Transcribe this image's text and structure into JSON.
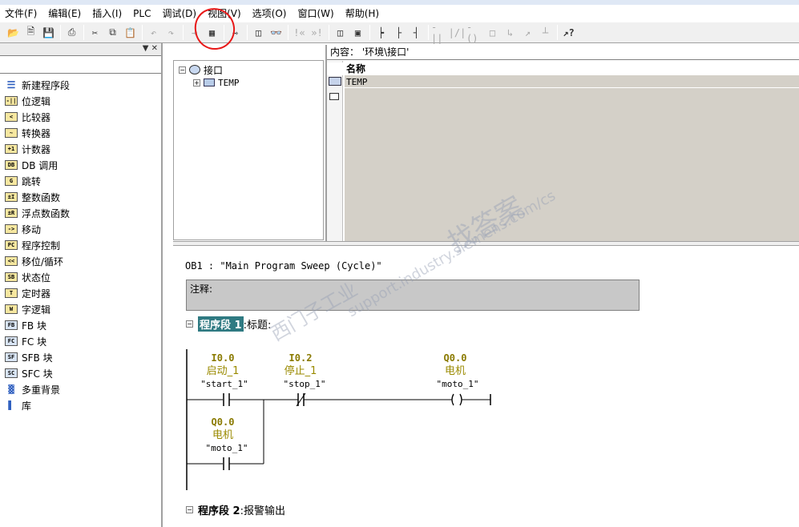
{
  "menu": [
    "文件(F)",
    "编辑(E)",
    "插入(I)",
    "PLC",
    "调试(D)",
    "视图(V)",
    "选项(O)",
    "窗口(W)",
    "帮助(H)"
  ],
  "toolbar_icons": [
    "new-icon",
    "open-icon",
    "save-icon",
    "print-icon",
    "cut-icon",
    "copy-icon",
    "paste-icon",
    "undo-icon",
    "redo-icon",
    "download-icon",
    "module-info-icon",
    "overview-icon",
    "accessible-nodes-icon",
    "monitor-icon",
    "network-prev-icon",
    "network-next-icon",
    "detail-view-icon",
    "overview-window-icon",
    "ladder-insert-icon",
    "branch-open-icon",
    "branch-close-icon",
    "contact-no-icon",
    "contact-nc-icon",
    "coil-icon",
    "empty-box-icon",
    "branch-arrow-icon",
    "connection-icon",
    "help-icon"
  ],
  "left_panel": {
    "items": [
      {
        "label": "新建程序段",
        "icon": "new-network-icon",
        "ico": ""
      },
      {
        "label": "位逻辑",
        "icon": "bit-logic-icon",
        "ico": "-||"
      },
      {
        "label": "比较器",
        "icon": "comparator-icon",
        "ico": "<"
      },
      {
        "label": "转换器",
        "icon": "converter-icon",
        "ico": "~"
      },
      {
        "label": "计数器",
        "icon": "counter-icon",
        "ico": "+1"
      },
      {
        "label": "DB 调用",
        "icon": "db-call-icon",
        "ico": "DB"
      },
      {
        "label": "跳转",
        "icon": "jump-icon",
        "ico": "G"
      },
      {
        "label": "整数函数",
        "icon": "integer-function-icon",
        "ico": "±I"
      },
      {
        "label": "浮点数函数",
        "icon": "float-function-icon",
        "ico": "±R"
      },
      {
        "label": "移动",
        "icon": "move-icon",
        "ico": "->"
      },
      {
        "label": "程序控制",
        "icon": "program-control-icon",
        "ico": "PC"
      },
      {
        "label": "移位/循环",
        "icon": "shift-rotate-icon",
        "ico": "<<"
      },
      {
        "label": "状态位",
        "icon": "status-bit-icon",
        "ico": "SB"
      },
      {
        "label": "定时器",
        "icon": "timer-icon",
        "ico": "T"
      },
      {
        "label": "字逻辑",
        "icon": "word-logic-icon",
        "ico": "W"
      },
      {
        "label": "FB 块",
        "icon": "fb-block-icon",
        "ico": "FB"
      },
      {
        "label": "FC 块",
        "icon": "fc-block-icon",
        "ico": "FC"
      },
      {
        "label": "SFB 块",
        "icon": "sfb-block-icon",
        "ico": "SF"
      },
      {
        "label": "SFC 块",
        "icon": "sfc-block-icon",
        "ico": "SC"
      },
      {
        "label": "多重背景",
        "icon": "multi-instance-icon",
        "ico": ""
      },
      {
        "label": "库",
        "icon": "library-icon",
        "ico": ""
      }
    ]
  },
  "tree": {
    "root": "接口",
    "child": "TEMP"
  },
  "content_pane": {
    "title": "内容：  '环境\\接口'",
    "column_name": "名称",
    "rows": [
      "TEMP"
    ]
  },
  "editor": {
    "ob_title": "OB1 :  \"Main Program Sweep (Cycle)\"",
    "comment_label": "注释:",
    "network1": {
      "label": "程序段 1",
      "suffix": ":标题:"
    },
    "network2": {
      "label": "程序段 2",
      "suffix": ":报警输出"
    },
    "contact1": {
      "address": "I0.0",
      "symbol": "启动_1",
      "name": "\"start_1\""
    },
    "contact2": {
      "address": "I0.2",
      "symbol": "停止_1",
      "name": "\"stop_1\""
    },
    "coil": {
      "address": "Q0.0",
      "symbol": "电机",
      "name": "\"moto_1\""
    },
    "contact3": {
      "address": "Q0.0",
      "symbol": "电机",
      "name": "\"moto_1\""
    }
  },
  "colors": {
    "address": "#8a7a00",
    "symbol": "#9a8a00",
    "annotation": "#e81818",
    "selection": "#2f7a82"
  },
  "watermark": {
    "line1": "西门子工业",
    "line2": "support.industry.siemens.com/cs",
    "line3": "找答案"
  }
}
